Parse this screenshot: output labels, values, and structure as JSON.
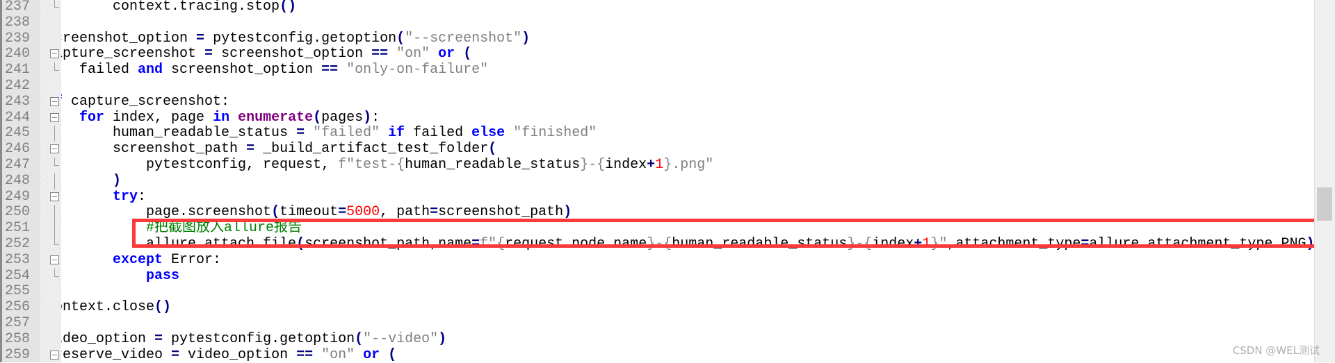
{
  "editor": {
    "lines": [
      {
        "n": "237",
        "fold": "end",
        "tokens": [
          [
            "t",
            "        context.tracing.stop"
          ],
          [
            "o",
            "()"
          ]
        ]
      },
      {
        "n": "238",
        "fold": "none",
        "tokens": []
      },
      {
        "n": "239",
        "fold": "none",
        "tokens": [
          [
            "t",
            "screenshot_option "
          ],
          [
            "o",
            "="
          ],
          [
            "t",
            " pytestconfig.getoption"
          ],
          [
            "o",
            "("
          ],
          [
            "s",
            "\"--screenshot\""
          ],
          [
            "o",
            ")"
          ]
        ]
      },
      {
        "n": "240",
        "fold": "box",
        "tokens": [
          [
            "t",
            "capture_screenshot "
          ],
          [
            "o",
            "="
          ],
          [
            "t",
            " screenshot_option "
          ],
          [
            "o",
            "=="
          ],
          [
            "t",
            " "
          ],
          [
            "s",
            "\"on\""
          ],
          [
            "t",
            " "
          ],
          [
            "k",
            "or"
          ],
          [
            "t",
            " "
          ],
          [
            "o",
            "("
          ]
        ]
      },
      {
        "n": "241",
        "fold": "end",
        "tokens": [
          [
            "t",
            "    failed "
          ],
          [
            "k",
            "and"
          ],
          [
            "t",
            " screenshot_option "
          ],
          [
            "o",
            "=="
          ],
          [
            "t",
            " "
          ],
          [
            "s",
            "\"only-on-failure\""
          ]
        ]
      },
      {
        "n": "242",
        "fold": "none",
        "tokens": []
      },
      {
        "n": "243",
        "fold": "box",
        "tokens": [
          [
            "k",
            "if"
          ],
          [
            "t",
            " capture_screenshot:"
          ]
        ]
      },
      {
        "n": "244",
        "fold": "box",
        "tokens": [
          [
            "t",
            "    "
          ],
          [
            "k",
            "for"
          ],
          [
            "t",
            " index, page "
          ],
          [
            "k",
            "in"
          ],
          [
            "t",
            " "
          ],
          [
            "b",
            "enumerate"
          ],
          [
            "o",
            "("
          ],
          [
            "t",
            "pages"
          ],
          [
            "o",
            ")"
          ],
          [
            "t",
            ":"
          ]
        ]
      },
      {
        "n": "245",
        "fold": "line",
        "tokens": [
          [
            "t",
            "        human_readable_status "
          ],
          [
            "o",
            "="
          ],
          [
            "t",
            " "
          ],
          [
            "s",
            "\"failed\""
          ],
          [
            "t",
            " "
          ],
          [
            "k",
            "if"
          ],
          [
            "t",
            " failed "
          ],
          [
            "k",
            "else"
          ],
          [
            "t",
            " "
          ],
          [
            "s",
            "\"finished\""
          ]
        ]
      },
      {
        "n": "246",
        "fold": "box",
        "tokens": [
          [
            "t",
            "        screenshot_path "
          ],
          [
            "o",
            "="
          ],
          [
            "t",
            " _build_artifact_test_folder"
          ],
          [
            "o",
            "("
          ]
        ]
      },
      {
        "n": "247",
        "fold": "end",
        "tokens": [
          [
            "t",
            "            pytestconfig, request, "
          ],
          [
            "s",
            "f\"test-{"
          ],
          [
            "t",
            "human_readable_status"
          ],
          [
            "s",
            "}-{"
          ],
          [
            "t",
            "index"
          ],
          [
            "o",
            "+"
          ],
          [
            "n",
            "1"
          ],
          [
            "s",
            "}.png\""
          ]
        ]
      },
      {
        "n": "248",
        "fold": "line",
        "tokens": [
          [
            "t",
            "        "
          ],
          [
            "o",
            ")"
          ]
        ]
      },
      {
        "n": "249",
        "fold": "box",
        "tokens": [
          [
            "t",
            "        "
          ],
          [
            "k",
            "try"
          ],
          [
            "t",
            ":"
          ]
        ]
      },
      {
        "n": "250",
        "fold": "line",
        "tokens": [
          [
            "t",
            "            page.screenshot"
          ],
          [
            "o",
            "("
          ],
          [
            "t",
            "timeout"
          ],
          [
            "o",
            "="
          ],
          [
            "n",
            "5000"
          ],
          [
            "t",
            ", path"
          ],
          [
            "o",
            "="
          ],
          [
            "t",
            "screenshot_path"
          ],
          [
            "o",
            ")"
          ]
        ]
      },
      {
        "n": "251",
        "fold": "line",
        "tokens": [
          [
            "t",
            "            "
          ],
          [
            "c",
            "#把截图放入allure报告"
          ]
        ]
      },
      {
        "n": "252",
        "fold": "end",
        "tokens": [
          [
            "t",
            "            allure.attach.file"
          ],
          [
            "o",
            "("
          ],
          [
            "t",
            "screenshot_path,name"
          ],
          [
            "o",
            "="
          ],
          [
            "s",
            "f\"{"
          ],
          [
            "t",
            "request.node.name"
          ],
          [
            "s",
            "}-{"
          ],
          [
            "t",
            "human_readable_status"
          ],
          [
            "s",
            "}-{"
          ],
          [
            "t",
            "index"
          ],
          [
            "o",
            "+"
          ],
          [
            "n",
            "1"
          ],
          [
            "s",
            "}\""
          ],
          [
            "t",
            ",attachment_type"
          ],
          [
            "o",
            "="
          ],
          [
            "t",
            "allure.attachment_type.PNG"
          ],
          [
            "o",
            ")"
          ]
        ]
      },
      {
        "n": "253",
        "fold": "box",
        "tokens": [
          [
            "t",
            "        "
          ],
          [
            "k",
            "except"
          ],
          [
            "t",
            " Error:"
          ]
        ]
      },
      {
        "n": "254",
        "fold": "end",
        "tokens": [
          [
            "t",
            "            "
          ],
          [
            "k",
            "pass"
          ]
        ]
      },
      {
        "n": "255",
        "fold": "none",
        "tokens": []
      },
      {
        "n": "256",
        "fold": "none",
        "tokens": [
          [
            "t",
            "context.close"
          ],
          [
            "o",
            "()"
          ]
        ]
      },
      {
        "n": "257",
        "fold": "none",
        "tokens": []
      },
      {
        "n": "258",
        "fold": "none",
        "tokens": [
          [
            "t",
            "video_option "
          ],
          [
            "o",
            "="
          ],
          [
            "t",
            " pytestconfig.getoption"
          ],
          [
            "o",
            "("
          ],
          [
            "s",
            "\"--video\""
          ],
          [
            "o",
            ")"
          ]
        ]
      },
      {
        "n": "259",
        "fold": "box",
        "tokens": [
          [
            "t",
            "preserve_video "
          ],
          [
            "o",
            "="
          ],
          [
            "t",
            " video_option "
          ],
          [
            "o",
            "=="
          ],
          [
            "t",
            " "
          ],
          [
            "s",
            "\"on\""
          ],
          [
            "t",
            " "
          ],
          [
            "k",
            "or"
          ],
          [
            "t",
            " "
          ],
          [
            "o",
            "("
          ]
        ]
      }
    ],
    "highlight_color": "#fc3a3a"
  },
  "watermark": "CSDN @WEL测试"
}
